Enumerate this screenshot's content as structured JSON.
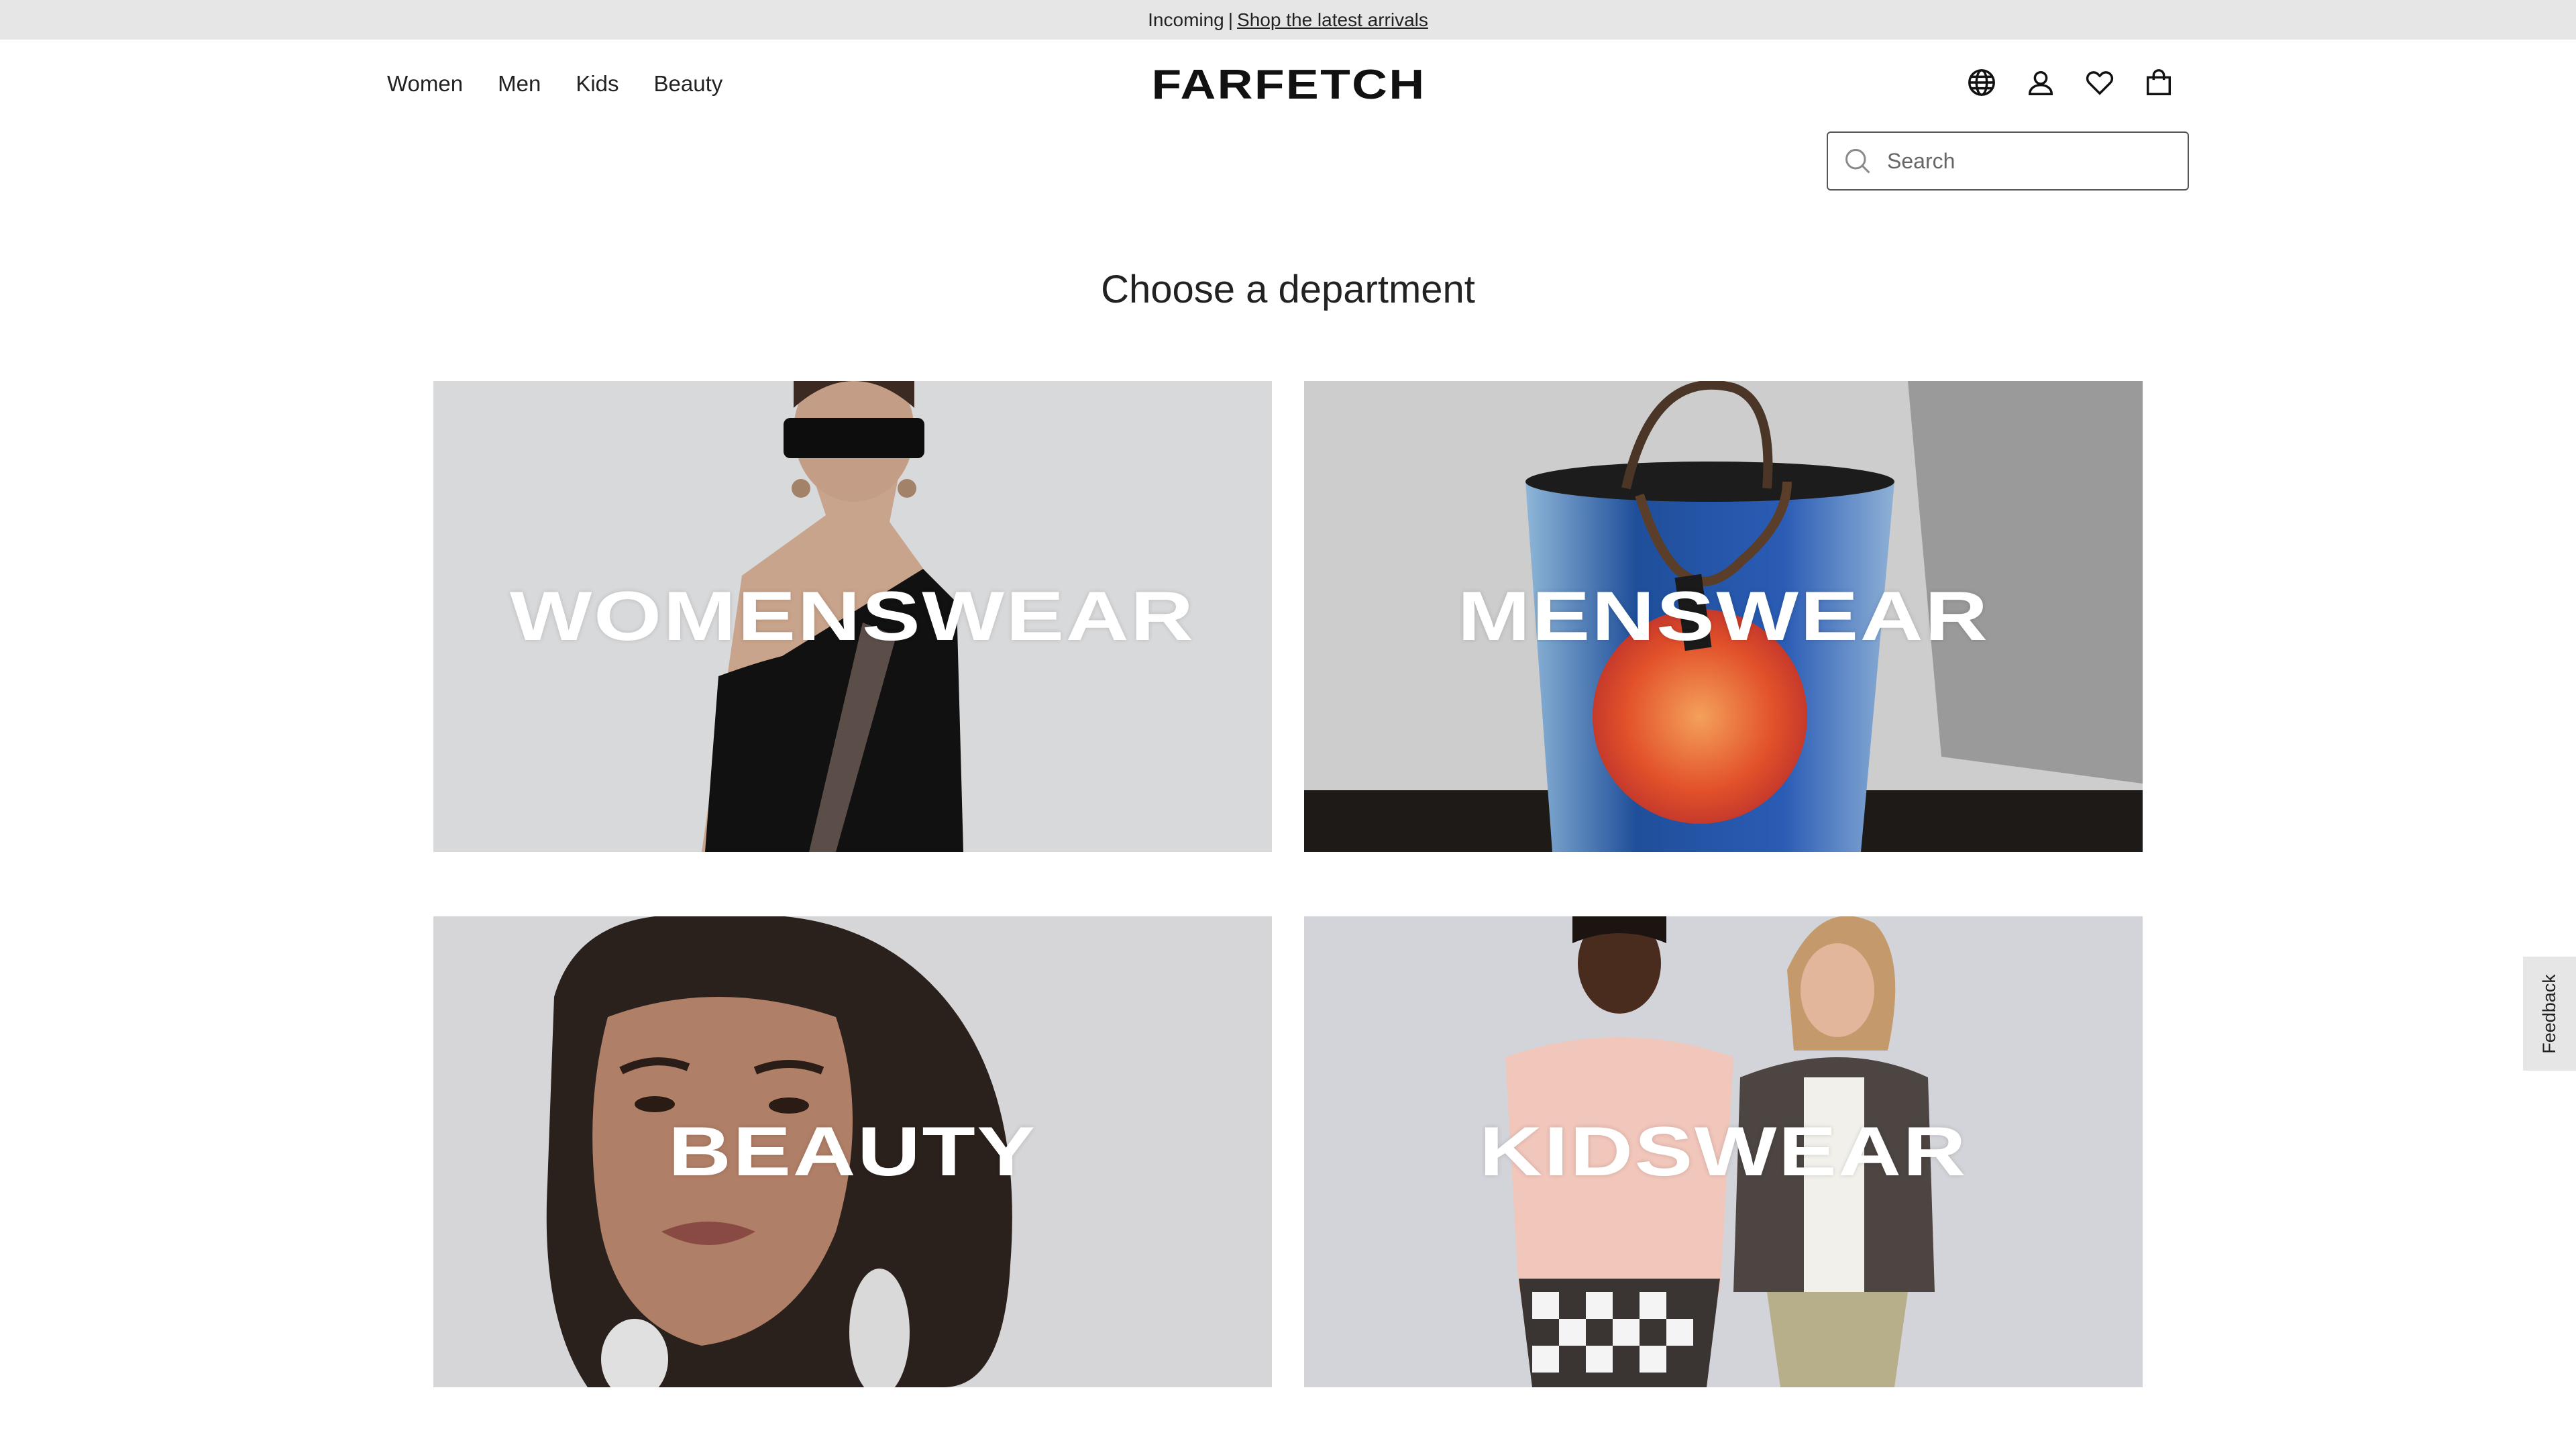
{
  "promo": {
    "prefix": "Incoming",
    "separator": "|",
    "link": "Shop the latest arrivals"
  },
  "nav": {
    "items": [
      {
        "label": "Women"
      },
      {
        "label": "Men"
      },
      {
        "label": "Kids"
      },
      {
        "label": "Beauty"
      }
    ]
  },
  "brand": {
    "logo": "FARFETCH"
  },
  "header_icons": [
    "globe-icon",
    "account-icon",
    "heart-icon",
    "bag-icon"
  ],
  "search": {
    "placeholder": "Search",
    "value": ""
  },
  "main": {
    "title": "Choose a department",
    "departments": [
      {
        "label": "WOMENSWEAR"
      },
      {
        "label": "MENSWEAR"
      },
      {
        "label": "BEAUTY"
      },
      {
        "label": "KIDSWEAR"
      }
    ]
  },
  "feedback": {
    "label": "Feedback"
  },
  "colors": {
    "promo_bg": "#e6e6e6",
    "text": "#222222",
    "tile_text": "#ffffff"
  }
}
